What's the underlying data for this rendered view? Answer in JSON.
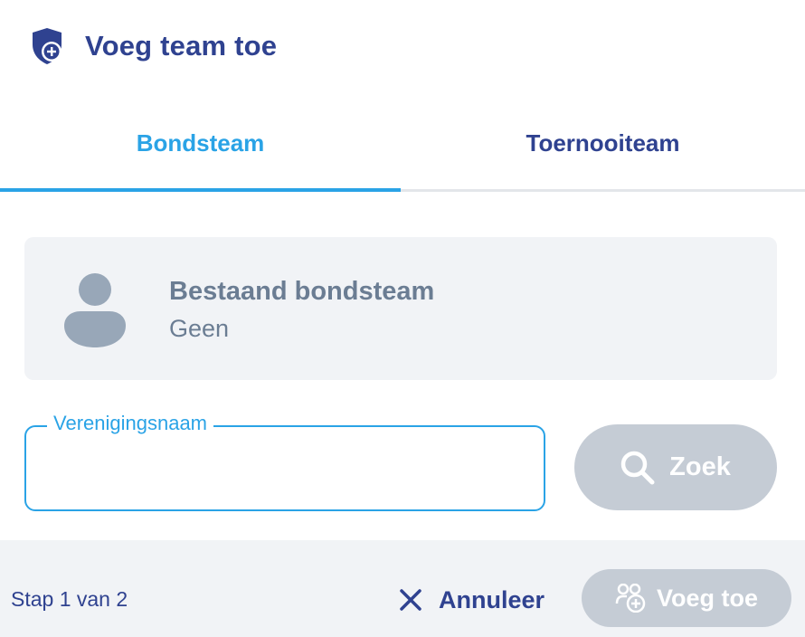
{
  "header": {
    "title": "Voeg team toe",
    "icon": "shield-plus-icon"
  },
  "tabs": [
    {
      "label": "Bondsteam",
      "active": true
    },
    {
      "label": "Toernooiteam",
      "active": false
    }
  ],
  "existing_team": {
    "title": "Bestaand bondsteam",
    "value": "Geen",
    "icon": "person-icon"
  },
  "search": {
    "field_label": "Verenigingsnaam",
    "value": "",
    "button_label": "Zoek",
    "icon": "search-icon"
  },
  "footer": {
    "step": "Stap 1 van 2",
    "cancel_label": "Annuleer",
    "add_label": "Voeg toe"
  },
  "colors": {
    "primary": "#2f4290",
    "accent": "#2aa3e6",
    "disabled": "#c5ccd5",
    "muted": "#6b7d93"
  }
}
